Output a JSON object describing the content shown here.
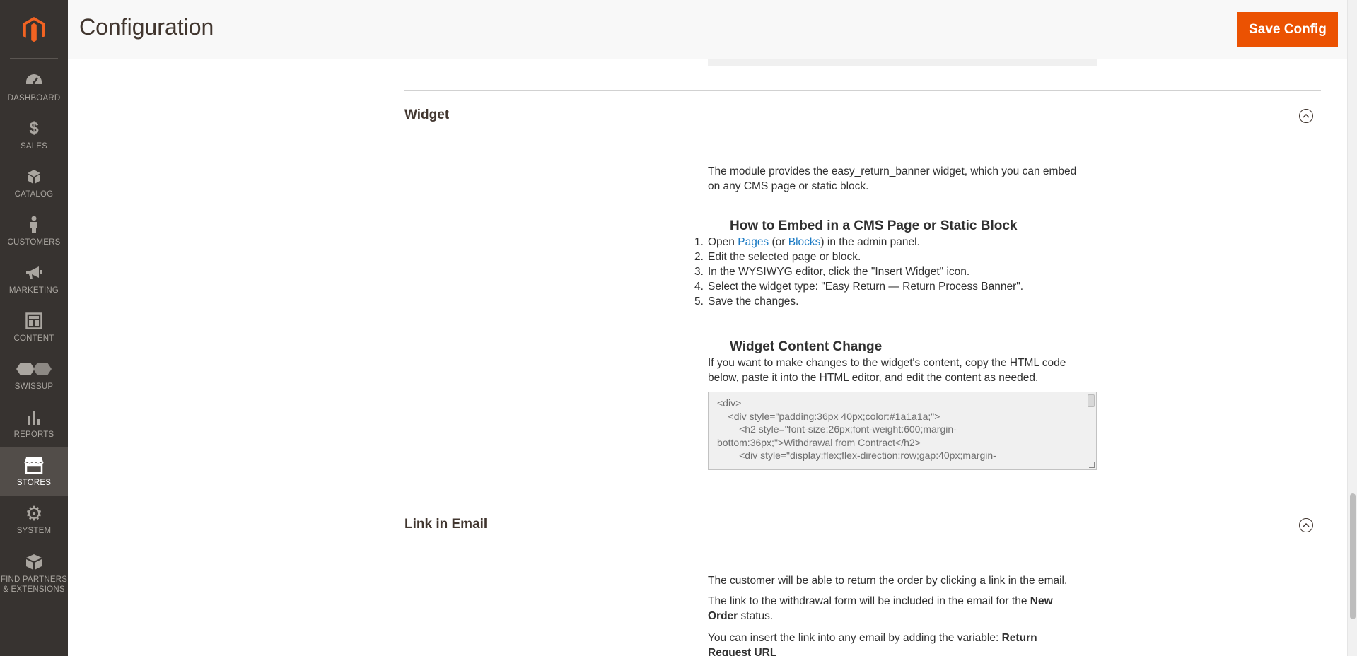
{
  "sidebar": {
    "items": [
      {
        "label": "DASHBOARD",
        "icon": "dashboard-icon"
      },
      {
        "label": "SALES",
        "icon": "dollar-icon"
      },
      {
        "label": "CATALOG",
        "icon": "cube-icon"
      },
      {
        "label": "CUSTOMERS",
        "icon": "person-icon"
      },
      {
        "label": "MARKETING",
        "icon": "megaphone-icon"
      },
      {
        "label": "CONTENT",
        "icon": "layout-icon"
      },
      {
        "label": "SWISSUP",
        "icon": "swissup-icon"
      },
      {
        "label": "REPORTS",
        "icon": "bar-chart-icon"
      },
      {
        "label": "STORES",
        "icon": "store-icon",
        "active": true
      },
      {
        "label": "SYSTEM",
        "icon": "gear-icon"
      },
      {
        "label": "FIND PARTNERS",
        "label2": "& EXTENSIONS",
        "icon": "blocks-icon"
      }
    ]
  },
  "header": {
    "title": "Configuration",
    "save_label": "Save Config"
  },
  "widget": {
    "title": "Widget",
    "intro_1": "The module provides the easy_return_banner widget, which you can embed",
    "intro_2": "on any CMS page or static block.",
    "embed_heading": "How to Embed in a CMS Page or Static Block",
    "steps": {
      "s1_num": "1.",
      "s1_pre": "Open ",
      "s1_link1": "Pages",
      "s1_mid": " (or ",
      "s1_link2": "Blocks",
      "s1_post": ") in the admin panel.",
      "s2_num": "2.",
      "s2": "Edit the selected page or block.",
      "s3_num": "3.",
      "s3": "In the WYSIWYG editor, click the \"Insert Widget\" icon.",
      "s4_num": "4.",
      "s4": "Select the widget type: \"Easy Return — Return Process Banner\".",
      "s5_num": "5.",
      "s5": "Save the changes."
    },
    "change_heading": "Widget Content Change",
    "change_1": "If you want to make changes to the widget's content, copy the HTML code",
    "change_2": "below, paste it into the HTML editor, and edit the content as needed.",
    "code": {
      "l1": "<div>",
      "l2": "    <div style=\"padding:36px 40px;color:#1a1a1a;\">",
      "l3": "        <h2 style=\"font-size:26px;font-weight:600;margin-",
      "l4": "bottom:36px;\">Withdrawal from Contract</h2>",
      "l5": "",
      "l6": "        <div style=\"display:flex;flex-direction:row;gap:40px;margin-"
    }
  },
  "link_email": {
    "title": "Link in Email",
    "p1": "The customer will be able to return the order by clicking a link in the email.",
    "p2_pre": "The link to the withdrawal form will be included in the email for the ",
    "p2_bold1": "New",
    "p2_bold2": "Order",
    "p2_post": " status.",
    "p3_pre": "You can insert the link into any email by adding the variable: ",
    "p3_bold1": "Return",
    "p3_bold2": "Request URL"
  }
}
